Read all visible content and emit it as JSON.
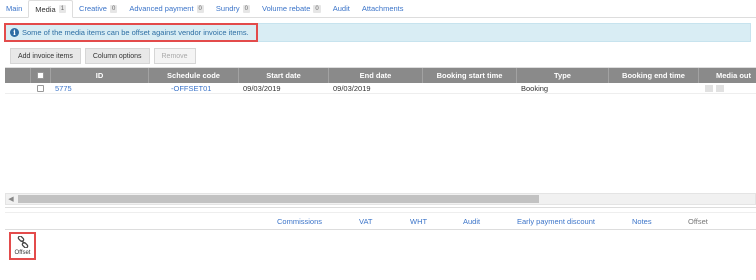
{
  "tabs": [
    {
      "label": "Main",
      "badge": null
    },
    {
      "label": "Media",
      "badge": "1"
    },
    {
      "label": "Creative",
      "badge": "0"
    },
    {
      "label": "Advanced payment",
      "badge": "0"
    },
    {
      "label": "Sundry",
      "badge": "0"
    },
    {
      "label": "Volume rebate",
      "badge": "0"
    },
    {
      "label": "Audit",
      "badge": null
    },
    {
      "label": "Attachments",
      "badge": null
    }
  ],
  "active_tab": "Media",
  "info": {
    "icon": "info-icon",
    "message": "Some of the media items can be offset against vendor invoice items."
  },
  "toolbar": {
    "add_label": "Add invoice items",
    "columns_label": "Column options",
    "remove_label": "Remove"
  },
  "grid": {
    "columns": [
      "",
      "ID",
      "Schedule code",
      "Start date",
      "End date",
      "Booking start time",
      "Type",
      "Booking end time",
      "Media out"
    ],
    "rows": [
      {
        "id": "5775",
        "schedule_code": "-OFFSET01",
        "start_date": "09/03/2019",
        "end_date": "09/03/2019",
        "booking_start_time": "",
        "type": "Booking",
        "booking_end_time": "",
        "media_out": ""
      }
    ]
  },
  "bottom_tabs": [
    "Commissions",
    "VAT",
    "WHT",
    "Audit",
    "Early payment discount",
    "Notes",
    "Offset"
  ],
  "active_bottom_tab": "Offset",
  "offset_action": {
    "label": "Offset",
    "icon": "link-chain-icon"
  },
  "colors": {
    "link": "#3b74c9",
    "info_bg": "#d9edf4",
    "highlight": "#e34b4b",
    "header_bg": "#8a8a8a"
  }
}
